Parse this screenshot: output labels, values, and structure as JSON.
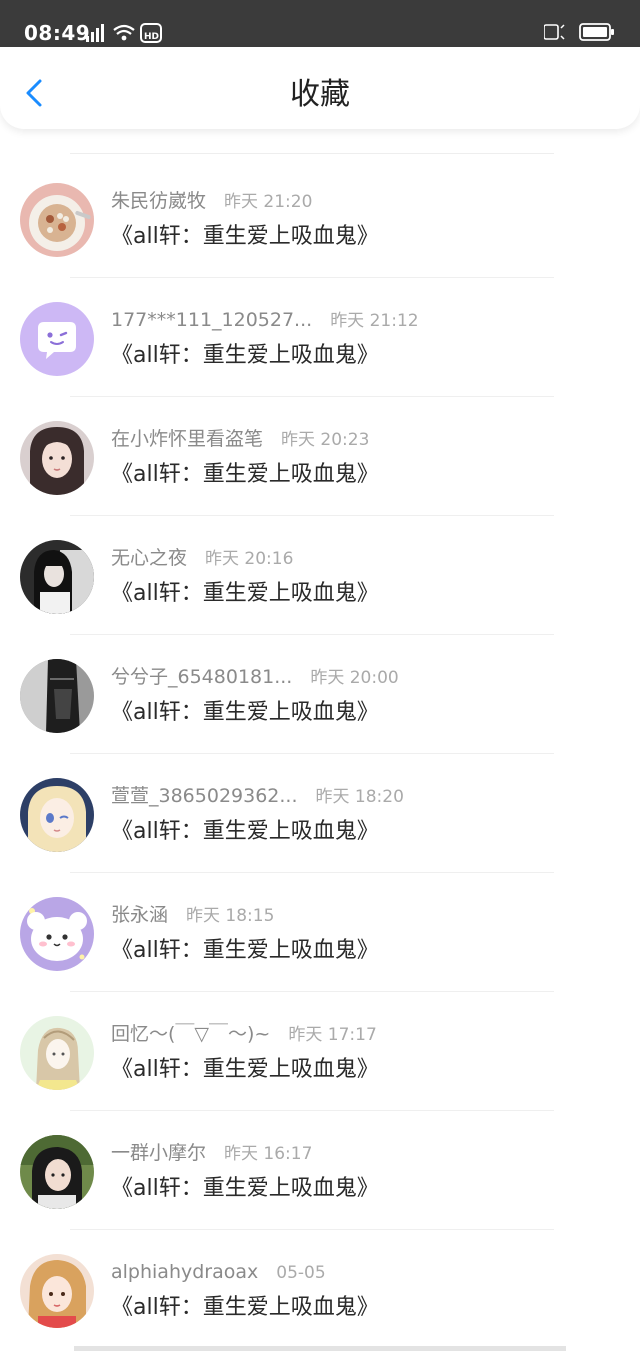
{
  "status_bar": {
    "time": "08:49",
    "network": "4G"
  },
  "header": {
    "title": "收藏"
  },
  "items": [
    {
      "user": "朱民彷崴牧",
      "time": "昨天 21:20",
      "book": "《all轩：重生爱上吸血鬼》",
      "avatar": "food-plate"
    },
    {
      "user": "177***111_120527...",
      "time": "昨天 21:12",
      "book": "《all轩：重生爱上吸血鬼》",
      "avatar": "default-chat"
    },
    {
      "user": "在小炸怀里看盗笔",
      "time": "昨天 20:23",
      "book": "《all轩：重生爱上吸血鬼》",
      "avatar": "girl-portrait"
    },
    {
      "user": "无心之夜",
      "time": "昨天 20:16",
      "book": "《all轩：重生爱上吸血鬼》",
      "avatar": "girl-dark"
    },
    {
      "user": "兮兮子_65480181...",
      "time": "昨天 20:00",
      "book": "《all轩：重生爱上吸血鬼》",
      "avatar": "grayscale-figure"
    },
    {
      "user": "萱萱_3865029362...",
      "time": "昨天 18:20",
      "book": "《all轩：重生爱上吸血鬼》",
      "avatar": "anime-girl"
    },
    {
      "user": "张永涵",
      "time": "昨天 18:15",
      "book": "《all轩：重生爱上吸血鬼》",
      "avatar": "cute-character"
    },
    {
      "user": "回忆～(￣▽￣～)~",
      "time": "昨天 17:17",
      "book": "《all轩：重生爱上吸血鬼》",
      "avatar": "sketch-girl"
    },
    {
      "user": "一群小摩尔",
      "time": "昨天 16:17",
      "book": "《all轩：重生爱上吸血鬼》",
      "avatar": "girl-green"
    },
    {
      "user": "alphiahydraoax",
      "time": "05-05",
      "book": "《all轩：重生爱上吸血鬼》",
      "avatar": "girl-blonde"
    }
  ]
}
